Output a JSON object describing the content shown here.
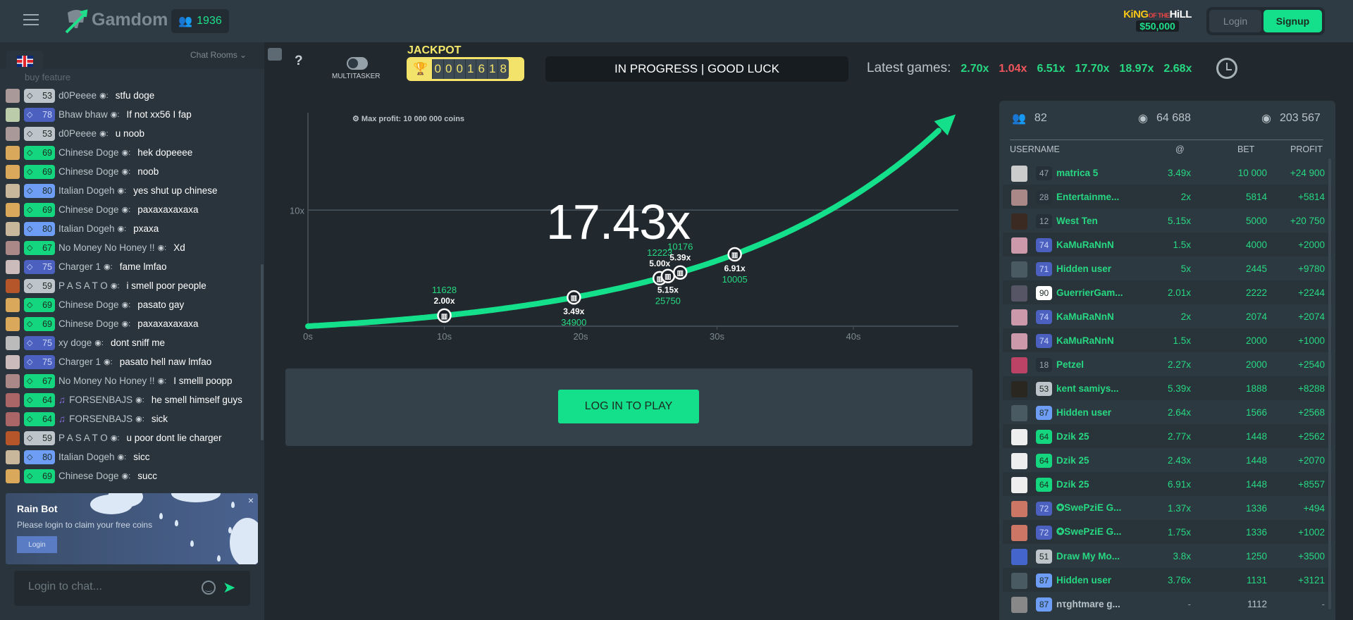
{
  "header": {
    "brand": "Gamdom",
    "online_count": "1936",
    "promo": {
      "line1a": "KiNG",
      "line1b": "OF THE",
      "line1c": "HiLL",
      "prize": "$50,000"
    },
    "login_label": "Login",
    "signup_label": "Signup"
  },
  "chat": {
    "rooms_label": "Chat Rooms",
    "language": "English (UK flag)",
    "partial_message": "buy feature",
    "messages": [
      {
        "level": "53",
        "tier": "grey",
        "user": "d0Peeee",
        "text": "stfu doge",
        "avatar": "#a99"
      },
      {
        "level": "78",
        "tier": "blue",
        "user": "Bhaw bhaw",
        "text": "If not xx56 I fap",
        "avatar": "#bca"
      },
      {
        "level": "53",
        "tier": "grey",
        "user": "d0Peeee",
        "text": "u noob",
        "avatar": "#a99"
      },
      {
        "level": "69",
        "tier": "green",
        "user": "Chinese Doge",
        "text": "hek dopeeee",
        "avatar": "#d9a85a"
      },
      {
        "level": "69",
        "tier": "green",
        "user": "Chinese Doge",
        "text": "noob",
        "avatar": "#d9a85a"
      },
      {
        "level": "80",
        "tier": "lightblue",
        "user": "Italian Dogeh",
        "text": "yes shut up chinese",
        "avatar": "#c8b79a"
      },
      {
        "level": "69",
        "tier": "green",
        "user": "Chinese Doge",
        "text": "paxaxaxaxaxa",
        "avatar": "#d9a85a"
      },
      {
        "level": "80",
        "tier": "lightblue",
        "user": "Italian Dogeh",
        "text": "pxaxa",
        "avatar": "#c8b79a"
      },
      {
        "level": "67",
        "tier": "green",
        "user": "No Money No Honey !!",
        "text": "Xd",
        "avatar": "#a88"
      },
      {
        "level": "75",
        "tier": "blue",
        "user": "Charger 1",
        "text": "fame lmfao",
        "avatar": "#cbb"
      },
      {
        "level": "59",
        "tier": "grey",
        "user": "P A S A T O",
        "text": "i smell poor people",
        "avatar": "#b5562a"
      },
      {
        "level": "69",
        "tier": "green",
        "user": "Chinese Doge",
        "text": "pasato gay",
        "avatar": "#d9a85a"
      },
      {
        "level": "69",
        "tier": "green",
        "user": "Chinese Doge",
        "text": "paxaxaxaxaxa",
        "avatar": "#d9a85a"
      },
      {
        "level": "75",
        "tier": "blue",
        "user": "xy doge",
        "text": "dont sniff me",
        "avatar": "#bbb"
      },
      {
        "level": "75",
        "tier": "blue",
        "user": "Charger 1",
        "text": "pasato hell naw lmfao",
        "avatar": "#cbb"
      },
      {
        "level": "67",
        "tier": "green",
        "user": "No Money No Honey !!",
        "text": "I smelll poopp",
        "avatar": "#a88"
      },
      {
        "level": "64",
        "tier": "green",
        "user": "FORSENBAJS",
        "text": "he smell himself guys",
        "avatar": "#a66",
        "music": true
      },
      {
        "level": "64",
        "tier": "green",
        "user": "FORSENBAJS",
        "text": "sick",
        "avatar": "#a66",
        "music": true
      },
      {
        "level": "59",
        "tier": "grey",
        "user": "P A S A T O",
        "text": "u poor dont lie charger",
        "avatar": "#b5562a"
      },
      {
        "level": "80",
        "tier": "lightblue",
        "user": "Italian Dogeh",
        "text": "sicc",
        "avatar": "#c8b79a"
      },
      {
        "level": "69",
        "tier": "green",
        "user": "Chinese Doge",
        "text": "succ",
        "avatar": "#d9a85a"
      }
    ],
    "rain_bot": {
      "title": "Rain Bot",
      "subtitle": "Please login to claim your free coins",
      "button": "Login"
    },
    "input_placeholder": "Login to chat..."
  },
  "toolbar": {
    "help": "?",
    "multitasker_label": "MULTITASKER",
    "multitasker_on": false,
    "jackpot_label": "JACKPOT",
    "jackpot_digits": [
      "0",
      "0",
      "0",
      "1",
      "6",
      "1",
      "8"
    ],
    "status": "IN PROGRESS | GOOD LUCK",
    "latest_label": "Latest games:",
    "latest_games": [
      {
        "value": "2.70x",
        "color": "#27d882"
      },
      {
        "value": "1.04x",
        "color": "#f0555b"
      },
      {
        "value": "6.51x",
        "color": "#27d882"
      },
      {
        "value": "17.70x",
        "color": "#27d882"
      },
      {
        "value": "18.97x",
        "color": "#27d882"
      },
      {
        "value": "2.68x",
        "color": "#27d882"
      }
    ]
  },
  "game": {
    "max_profit": "Max profit: 10 000 000 coins",
    "current_multiplier": "17.43x",
    "elapsed_seconds": 47.5,
    "x_ticks": [
      "0s",
      "10s",
      "20s",
      "30s",
      "40s"
    ],
    "y_ticks": [
      "10x"
    ],
    "cashouts": [
      {
        "t": 10,
        "mult": "2.00x",
        "amount": "11628",
        "pos": "above"
      },
      {
        "t": 19.5,
        "mult": "3.49x",
        "amount": "34900",
        "pos": "below"
      },
      {
        "t": 25.8,
        "mult": "5.00x",
        "amount": "12223",
        "pos": "above"
      },
      {
        "t": 26.4,
        "mult": "5.15x",
        "amount": "25750",
        "pos": "below"
      },
      {
        "t": 27.3,
        "mult": "5.39x",
        "amount": "10176",
        "pos": "above"
      },
      {
        "t": 31.3,
        "mult": "6.91x",
        "amount": "10005",
        "pos": "below"
      }
    ],
    "play_button": "LOG IN TO PLAY",
    "accent": "#14e08b"
  },
  "board": {
    "players": "82",
    "total_bet": "64 688",
    "total_profit": "203 567",
    "headers": {
      "username": "USERNAME",
      "at": "@",
      "bet": "BET",
      "profit": "PROFIT"
    },
    "rows": [
      {
        "level": "47",
        "tier": "dark",
        "name": "matrica 5",
        "at": "3.49x",
        "bet": "10 000",
        "profit": "+24 900",
        "avatar": "#ccc"
      },
      {
        "level": "28",
        "tier": "dark",
        "name": "Entertainme...",
        "at": "2x",
        "bet": "5814",
        "profit": "+5814",
        "avatar": "#a88"
      },
      {
        "level": "12",
        "tier": "dark",
        "name": "West Ten",
        "at": "5.15x",
        "bet": "5000",
        "profit": "+20 750",
        "avatar": "#3a2a22"
      },
      {
        "level": "74",
        "tier": "blue",
        "name": "KaMuRaNnN",
        "at": "1.5x",
        "bet": "4000",
        "profit": "+2000",
        "avatar": "#c9a"
      },
      {
        "level": "71",
        "tier": "blue",
        "name": "Hidden user",
        "at": "5x",
        "bet": "2445",
        "profit": "+9780",
        "avatar": "#4a5a62"
      },
      {
        "level": "90",
        "tier": "white",
        "name": "GuerrierGam...",
        "at": "2.01x",
        "bet": "2222",
        "profit": "+2244",
        "avatar": "#556"
      },
      {
        "level": "74",
        "tier": "blue",
        "name": "KaMuRaNnN",
        "at": "2x",
        "bet": "2074",
        "profit": "+2074",
        "avatar": "#c9a"
      },
      {
        "level": "74",
        "tier": "blue",
        "name": "KaMuRaNnN",
        "at": "1.5x",
        "bet": "2000",
        "profit": "+1000",
        "avatar": "#c9a"
      },
      {
        "level": "18",
        "tier": "dark",
        "name": "Petzel",
        "at": "2.27x",
        "bet": "2000",
        "profit": "+2540",
        "avatar": "#b46"
      },
      {
        "level": "53",
        "tier": "grey",
        "name": "kent samiys...",
        "at": "5.39x",
        "bet": "1888",
        "profit": "+8288",
        "avatar": "#2a2620"
      },
      {
        "level": "87",
        "tier": "lightblue",
        "name": "Hidden user",
        "at": "2.64x",
        "bet": "1566",
        "profit": "+2568",
        "avatar": "#4a5a62"
      },
      {
        "level": "64",
        "tier": "green",
        "name": "Dzik 25",
        "at": "2.77x",
        "bet": "1448",
        "profit": "+2562",
        "avatar": "#eee"
      },
      {
        "level": "64",
        "tier": "green",
        "name": "Dzik 25",
        "at": "2.43x",
        "bet": "1448",
        "profit": "+2070",
        "avatar": "#eee"
      },
      {
        "level": "64",
        "tier": "green",
        "name": "Dzik 25",
        "at": "6.91x",
        "bet": "1448",
        "profit": "+8557",
        "avatar": "#eee"
      },
      {
        "level": "72",
        "tier": "blue",
        "name": "✪SwePziE G...",
        "at": "1.37x",
        "bet": "1336",
        "profit": "+494",
        "avatar": "#c76"
      },
      {
        "level": "72",
        "tier": "blue",
        "name": "✪SwePziE G...",
        "at": "1.75x",
        "bet": "1336",
        "profit": "+1002",
        "avatar": "#c76"
      },
      {
        "level": "51",
        "tier": "grey",
        "name": "Draw My Mo...",
        "at": "3.8x",
        "bet": "1250",
        "profit": "+3500",
        "avatar": "#46c"
      },
      {
        "level": "87",
        "tier": "lightblue",
        "name": "Hidden user",
        "at": "3.76x",
        "bet": "1131",
        "profit": "+3121",
        "avatar": "#4a5a62"
      },
      {
        "level": "87",
        "tier": "lightblue",
        "name": "nτghtmare g...",
        "at": "-",
        "bet": "1112",
        "profit": "-",
        "avatar": "#888",
        "pending": true
      }
    ]
  }
}
